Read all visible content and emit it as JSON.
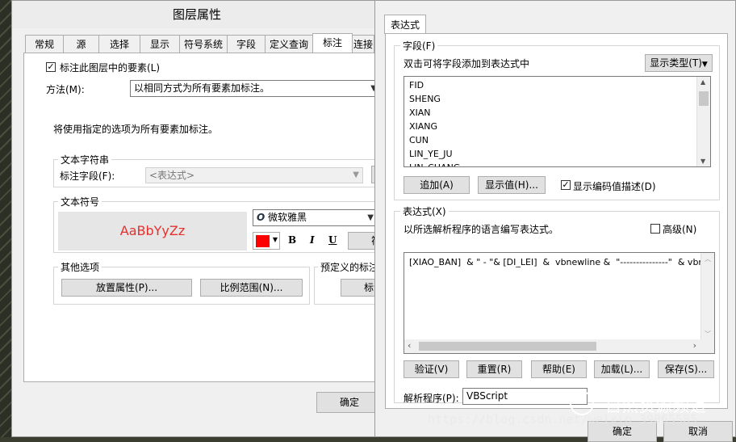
{
  "layer_dialog": {
    "title": "图层属性",
    "tabs": [
      "常规",
      "源",
      "选择",
      "显示",
      "符号系统",
      "字段",
      "定义查询",
      "标注",
      "连接"
    ],
    "label_checkbox": "标注此图层中的要素(L)",
    "method_label": "方法(M):",
    "method_value": "以相同方式为所有要素加标注。",
    "info_text": "将使用指定的选项为所有要素加标注。",
    "text_string_group": "文本字符串",
    "label_field_label": "标注字段(F):",
    "label_field_value": "<表达式>",
    "text_symbol_group": "文本符号",
    "preview_text": "AaBbYyZz",
    "font_name": "微软雅黑",
    "bold": "B",
    "italic": "I",
    "underline": "U",
    "symbol_button": "符号",
    "other_options_group": "其他选项",
    "placement_button": "放置属性(P)...",
    "scale_button": "比例范围(N)...",
    "predefined_group": "预定义的标注样式",
    "label_style_button": "标注",
    "ok_button": "确定",
    "color_red": "#ff0000",
    "preview_color": "#e53030"
  },
  "expr_dialog": {
    "tab": "表达式",
    "fields_group": "字段(F)",
    "fields_hint": "双击可将字段添加到表达式中",
    "show_type": "显示类型(T)",
    "fields": [
      "FID",
      "SHENG",
      "XIAN",
      "XIANG",
      "CUN",
      "LIN_YE_JU",
      "LIN_CHANG"
    ],
    "add_button": "追加(A)",
    "show_values_button": "显示值(H)...",
    "show_coded_desc": "显示编码值描述(D)",
    "expression_group": "表达式(X)",
    "expression_hint": "以所选解析程序的语言编写表达式。",
    "advanced": "高级(N)",
    "expression_text": "[XIAO_BAN]  & \" - \"& [DI_LEI]  &  vbnewline &  \"---------------\"  & vbnewline &",
    "verify_button": "验证(V)",
    "reset_button": "重置(R)",
    "help_button": "帮助(E)",
    "load_button": "加载(L)...",
    "save_button": "保存(S)...",
    "parser_label": "解析程序(P):",
    "parser_value": "VBScript",
    "ok_button": "确定",
    "cancel_button": "取消"
  },
  "overlay": {
    "watermark": "自然资源频道",
    "url": "https://blog.csdn.net/weixin_39065585"
  }
}
